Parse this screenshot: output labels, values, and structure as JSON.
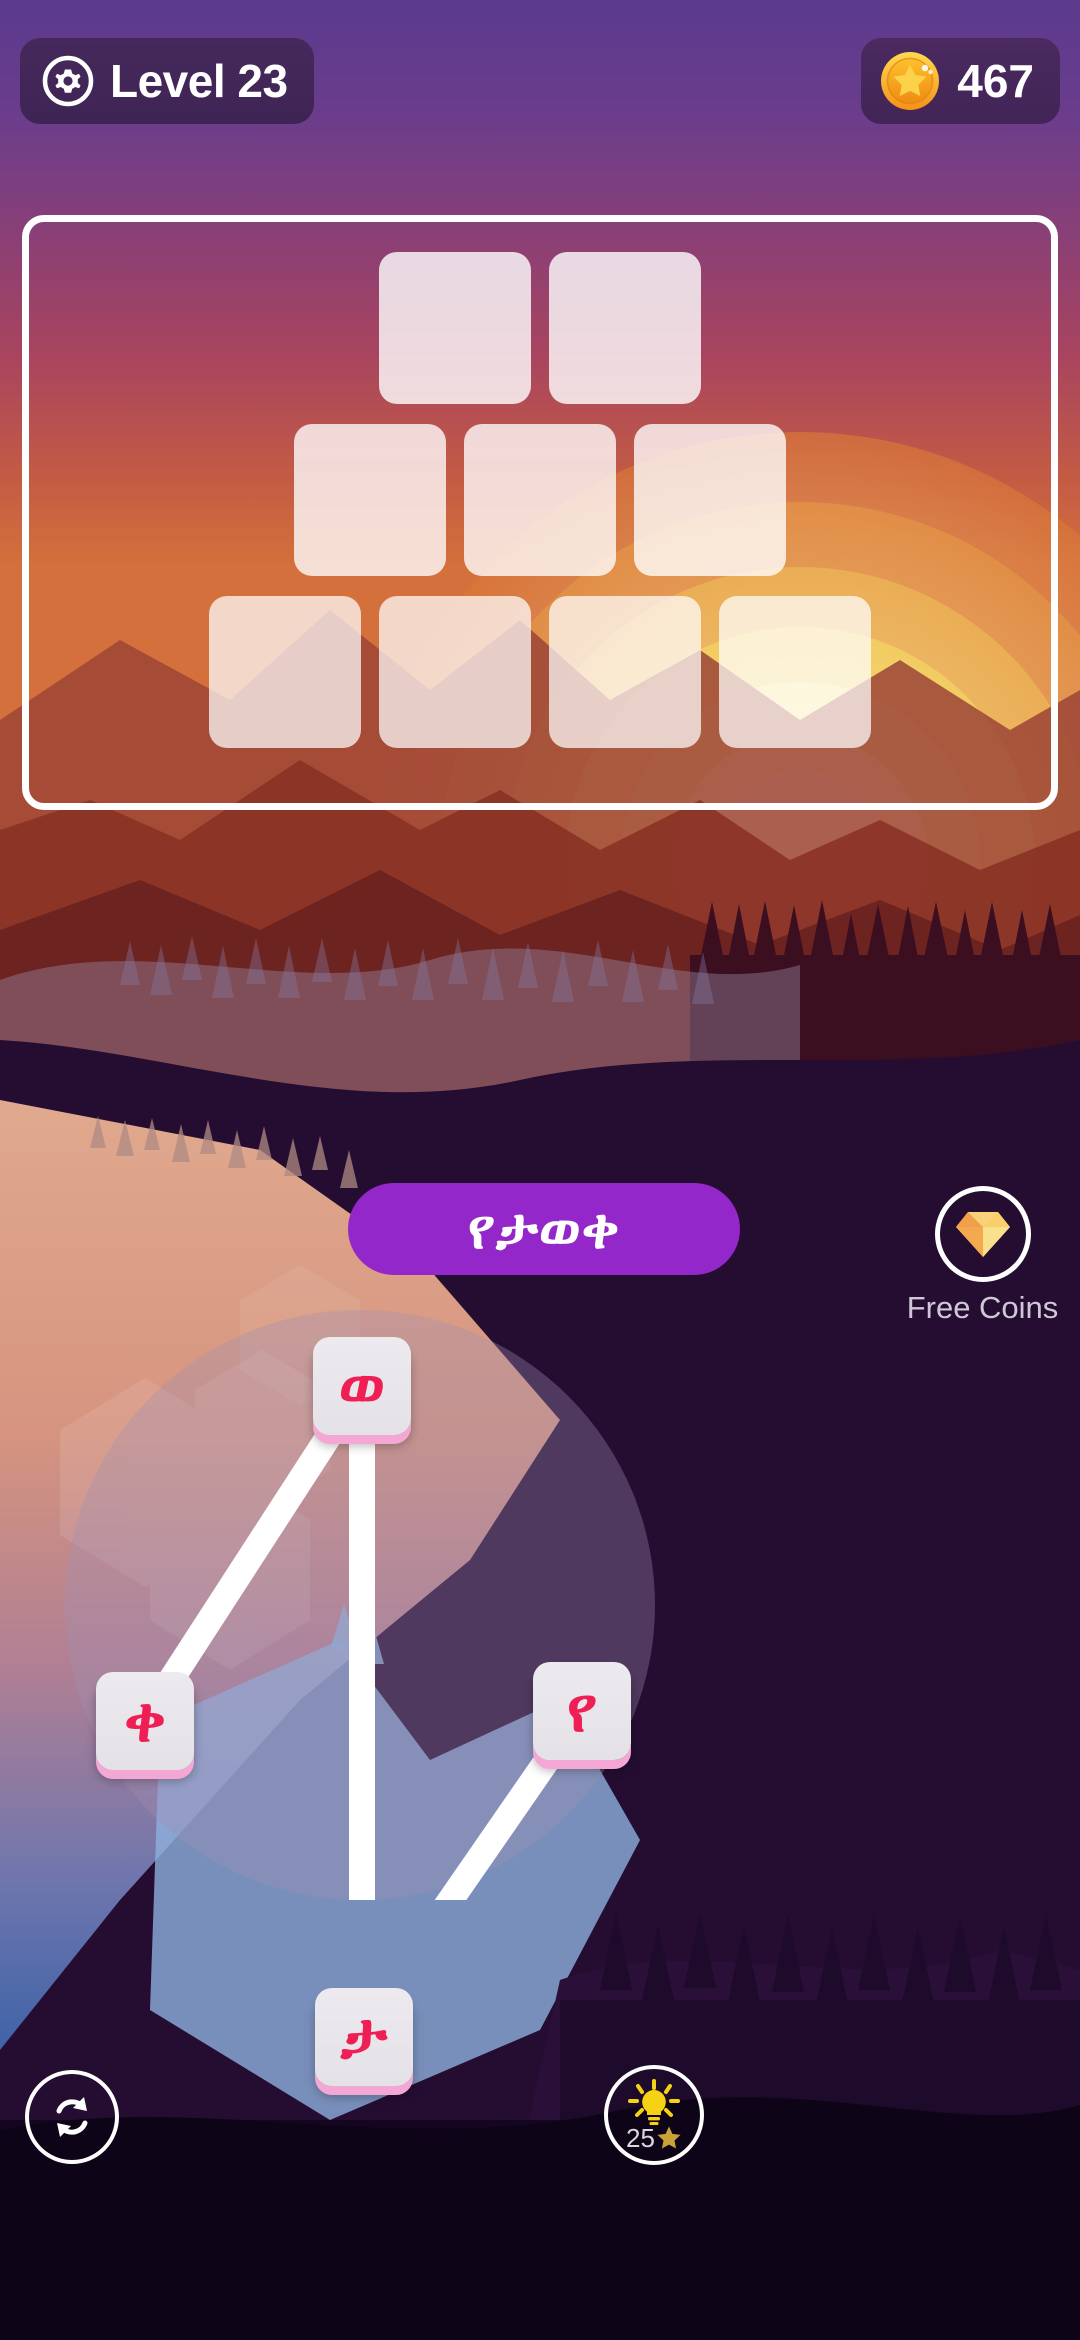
{
  "header": {
    "level_label": "Level 23",
    "settings_icon": "gear-icon",
    "coin_icon": "coin-star-icon",
    "coin_count": "467"
  },
  "board": {
    "rows": [
      {
        "slots": 2
      },
      {
        "slots": 3
      },
      {
        "slots": 4
      }
    ]
  },
  "word": {
    "text": "የታወቀ"
  },
  "free_coins": {
    "icon": "diamond-icon",
    "label": "Free Coins"
  },
  "wheel": {
    "letters": [
      {
        "char": "ወ",
        "position": "top"
      },
      {
        "char": "ቀ",
        "position": "left"
      },
      {
        "char": "የ",
        "position": "right"
      },
      {
        "char": "ታ",
        "position": "bottom"
      }
    ],
    "connections": [
      {
        "from": "left",
        "to": "top"
      },
      {
        "from": "top",
        "to": "bottom"
      },
      {
        "from": "bottom",
        "to": "right"
      }
    ]
  },
  "footer": {
    "shuffle_icon": "refresh-icon",
    "hint_icon": "lightbulb-icon",
    "hint_cost": "25",
    "hint_star_icon": "star-icon"
  },
  "colors": {
    "accent_purple": "#9427c9",
    "letter_red": "#ef1f56",
    "tile_pink_edge": "#f4a7d4",
    "coin_gold": "#fbbe28",
    "pill_bg": "#46295c"
  }
}
